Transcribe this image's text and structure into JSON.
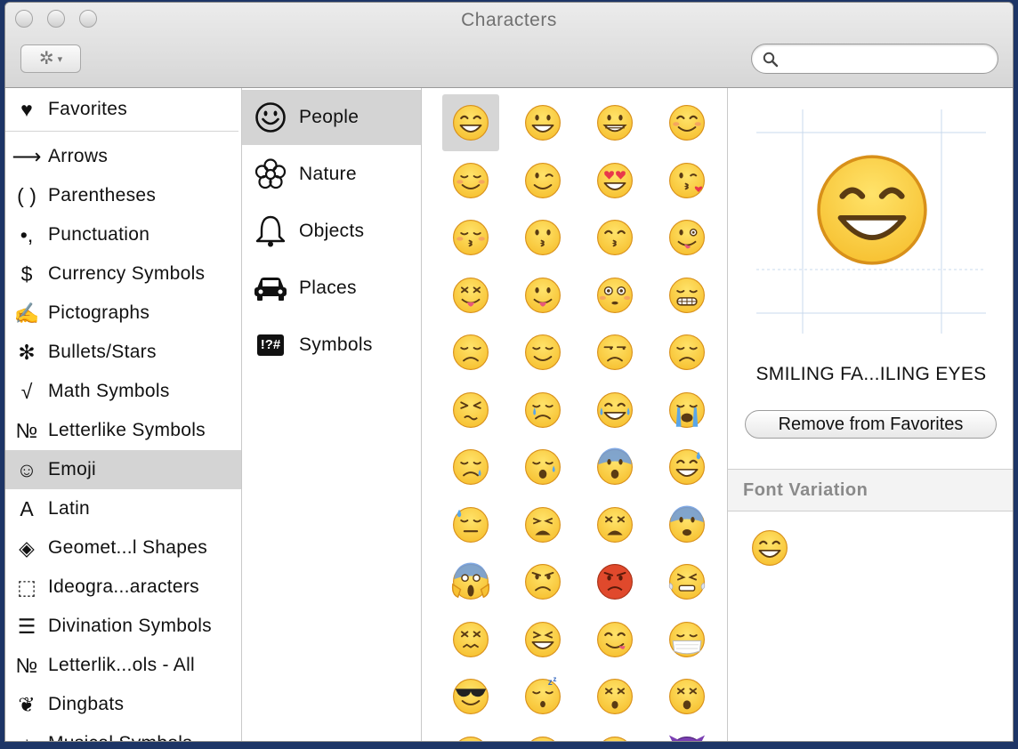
{
  "window": {
    "title": "Characters"
  },
  "toolbar": {
    "gear_glyph": "✲",
    "arrow_glyph": "▾",
    "search_placeholder": ""
  },
  "categories": {
    "favorites": {
      "icon": "♥",
      "label": "Favorites"
    },
    "items": [
      {
        "icon": "⟶",
        "label": "Arrows"
      },
      {
        "icon": "( )",
        "label": "Parentheses"
      },
      {
        "icon": "•,",
        "label": "Punctuation"
      },
      {
        "icon": "$",
        "label": "Currency Symbols"
      },
      {
        "icon": "✍",
        "label": "Pictographs"
      },
      {
        "icon": "✻",
        "label": "Bullets/Stars"
      },
      {
        "icon": "√",
        "label": "Math Symbols"
      },
      {
        "icon": "№",
        "label": "Letterlike Symbols"
      },
      {
        "icon": "☺",
        "label": "Emoji"
      },
      {
        "icon": "A",
        "label": "Latin"
      },
      {
        "icon": "◈",
        "label": "Geomet...l Shapes"
      },
      {
        "icon": "⬚",
        "label": "Ideogra...aracters"
      },
      {
        "icon": "☰",
        "label": "Divination Symbols"
      },
      {
        "icon": "№",
        "label": "Letterlik...ols - All"
      },
      {
        "icon": "❦",
        "label": "Dingbats"
      },
      {
        "icon": "♪",
        "label": "Musical Symbols"
      }
    ]
  },
  "subcategories": [
    {
      "icon": "smiley-icon",
      "label": "People"
    },
    {
      "icon": "flower-icon",
      "label": "Nature"
    },
    {
      "icon": "bell-icon",
      "label": "Objects"
    },
    {
      "icon": "car-icon",
      "label": "Places"
    },
    {
      "icon": "symbols-icon",
      "icon_text": "!?#",
      "label": "Symbols"
    }
  ],
  "emoji_grid": [
    [
      "grin",
      "smiley",
      "grinning",
      "blush"
    ],
    [
      "relaxed",
      "wink",
      "heart_eyes",
      "kiss_heart"
    ],
    [
      "kiss_closed",
      "kissing",
      "kissing_smile",
      "tongue_wink"
    ],
    [
      "tongue_closed",
      "tongue",
      "flushed",
      "grimace"
    ],
    [
      "pensive",
      "relieved",
      "unamused",
      "disappointed"
    ],
    [
      "persevere",
      "cry",
      "joy",
      "sob"
    ],
    [
      "sleepy",
      "disappointed_relieved",
      "cold_sweat",
      "sweat_smile"
    ],
    [
      "sweat",
      "weary",
      "tired",
      "fearful"
    ],
    [
      "scream",
      "angry",
      "rage",
      "triumph"
    ],
    [
      "confounded",
      "laughing",
      "yum",
      "mask"
    ],
    [
      "sunglasses",
      "sleeping",
      "dizzy",
      "astonished"
    ],
    [
      "worried",
      "frowning",
      "anguished",
      "imp"
    ]
  ],
  "colors": {
    "emoji_yellow": "#f7c233",
    "emoji_outline": "#d8901a",
    "emoji_red": "#e0492c",
    "emoji_purple": "#7b3fb3",
    "selection_gray": "#d4d4d4"
  },
  "inspector": {
    "char_name": "SMILING FA...ILING EYES",
    "remove_label": "Remove from Favorites",
    "font_variation_label": "Font Variation"
  }
}
